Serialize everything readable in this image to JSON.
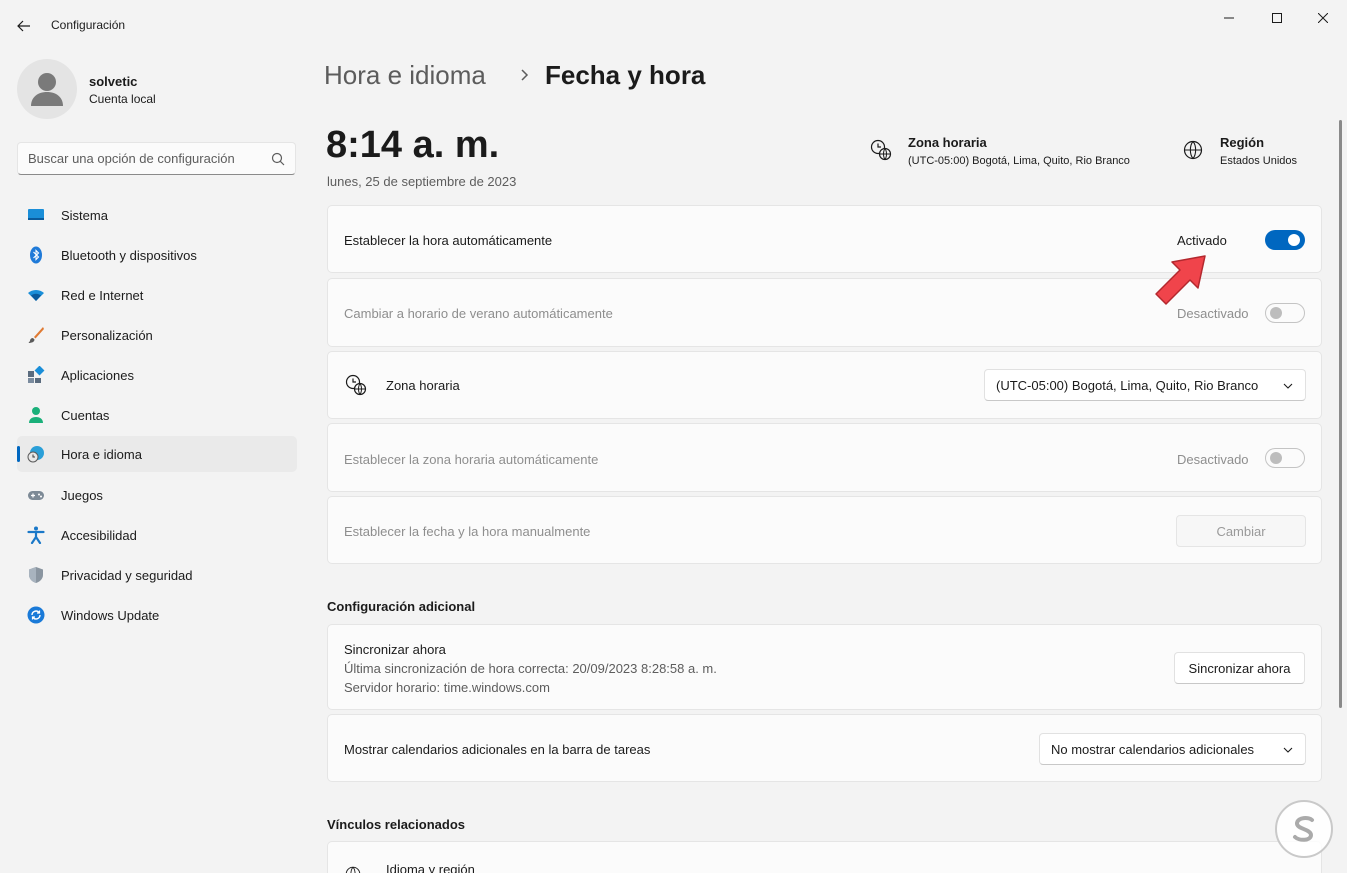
{
  "window": {
    "title": "Configuración"
  },
  "profile": {
    "name": "solvetic",
    "account_type": "Cuenta local"
  },
  "search": {
    "placeholder": "Buscar una opción de configuración"
  },
  "sidebar": {
    "items": [
      {
        "label": "Sistema",
        "icon": "monitor-icon"
      },
      {
        "label": "Bluetooth y dispositivos",
        "icon": "bluetooth-icon"
      },
      {
        "label": "Red e Internet",
        "icon": "wifi-icon"
      },
      {
        "label": "Personalización",
        "icon": "brush-icon"
      },
      {
        "label": "Aplicaciones",
        "icon": "apps-icon"
      },
      {
        "label": "Cuentas",
        "icon": "person-icon"
      },
      {
        "label": "Hora e idioma",
        "icon": "globe-clock-icon",
        "active": true
      },
      {
        "label": "Juegos",
        "icon": "gamepad-icon"
      },
      {
        "label": "Accesibilidad",
        "icon": "accessibility-icon"
      },
      {
        "label": "Privacidad y seguridad",
        "icon": "shield-icon"
      },
      {
        "label": "Windows Update",
        "icon": "update-icon"
      }
    ]
  },
  "breadcrumb": {
    "parent": "Hora e idioma",
    "current": "Fecha y hora"
  },
  "clock": {
    "time": "8:14 a. m.",
    "date": "lunes, 25 de septiembre de 2023"
  },
  "header_info": {
    "timezone_title": "Zona horaria",
    "timezone_value": "(UTC-05:00) Bogotá, Lima, Quito, Rio Branco",
    "region_title": "Región",
    "region_value": "Estados Unidos"
  },
  "settings": {
    "auto_time": {
      "label": "Establecer la hora automáticamente",
      "state": "Activado",
      "on": true
    },
    "dst": {
      "label": "Cambiar a horario de verano automáticamente",
      "state": "Desactivado",
      "on": false
    },
    "timezone": {
      "label": "Zona horaria",
      "selected": "(UTC-05:00) Bogotá, Lima, Quito, Rio Branco"
    },
    "auto_timezone": {
      "label": "Establecer la zona horaria automáticamente",
      "state": "Desactivado",
      "on": false
    },
    "manual": {
      "label": "Establecer la fecha y la hora manualmente",
      "button": "Cambiar"
    }
  },
  "additional": {
    "title": "Configuración adicional",
    "sync_title": "Sincronizar ahora",
    "sync_last": "Última sincronización de hora correcta: 20/09/2023 8:28:58 a. m.",
    "sync_server": "Servidor horario: time.windows.com",
    "sync_button": "Sincronizar ahora",
    "calendars_label": "Mostrar calendarios adicionales en la barra de tareas",
    "calendars_selected": "No mostrar calendarios adicionales"
  },
  "related": {
    "title": "Vínculos relacionados",
    "first_item": "Idioma y región"
  },
  "colors": {
    "accent": "#0067c0",
    "arrow": "#f0444b"
  }
}
